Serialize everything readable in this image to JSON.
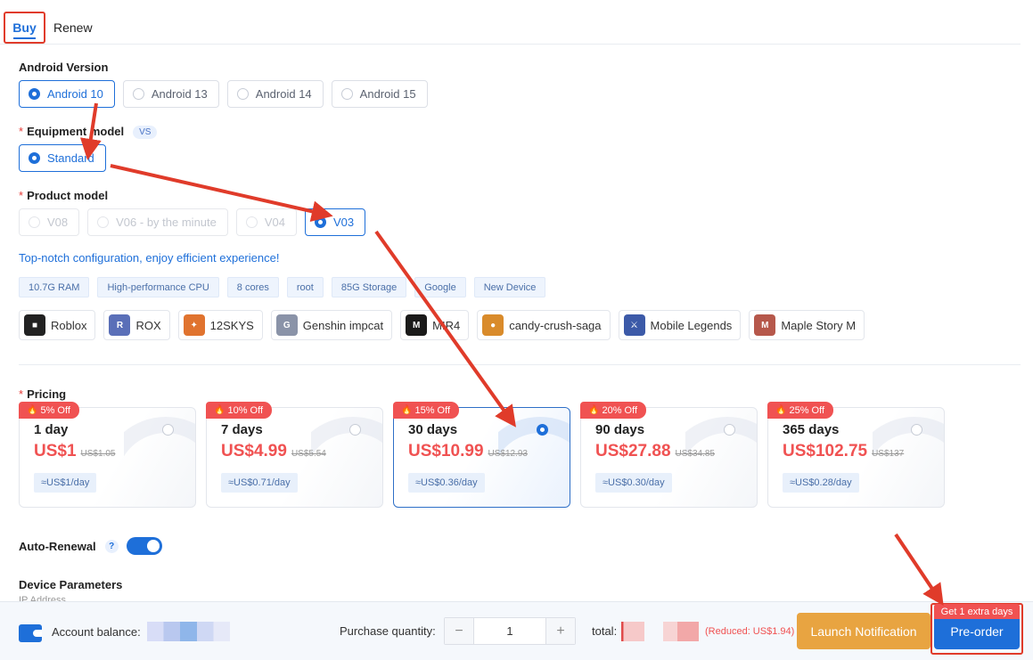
{
  "tabs": [
    {
      "label": "Buy",
      "active": true
    },
    {
      "label": "Renew",
      "active": false
    }
  ],
  "android_version": {
    "label": "Android Version",
    "options": [
      {
        "label": "Android 10",
        "selected": true
      },
      {
        "label": "Android 13",
        "selected": false
      },
      {
        "label": "Android 14",
        "selected": false
      },
      {
        "label": "Android 15",
        "selected": false
      }
    ]
  },
  "equipment_model": {
    "label": "Equipment model",
    "badge": "VS",
    "options": [
      {
        "label": "Standard",
        "selected": true
      }
    ]
  },
  "product_model": {
    "label": "Product model",
    "options": [
      {
        "label": "V08",
        "state": "disabled"
      },
      {
        "label": "V06 - by the minute",
        "state": "disabled"
      },
      {
        "label": "V04",
        "state": "disabled"
      },
      {
        "label": "V03",
        "state": "selected"
      }
    ]
  },
  "tagline": "Top-notch configuration, enjoy efficient experience!",
  "specs": [
    "10.7G RAM",
    "High-performance CPU",
    "8 cores",
    "root",
    "85G Storage",
    "Google",
    "New Device"
  ],
  "games": [
    {
      "label": "Roblox",
      "icon": "roblox-icon",
      "color": "#222222"
    },
    {
      "label": "ROX",
      "icon": "rox-icon",
      "color": "#5a6fb8"
    },
    {
      "label": "12SKYS",
      "icon": "12skys-icon",
      "color": "#e0732f"
    },
    {
      "label": "Genshin impcat",
      "icon": "genshin-icon",
      "color": "#8a93a8"
    },
    {
      "label": "MIR4",
      "icon": "mir4-icon",
      "color": "#1a1a1a"
    },
    {
      "label": "candy-crush-saga",
      "icon": "candy-crush-icon",
      "color": "#d98b2b"
    },
    {
      "label": "Mobile Legends",
      "icon": "mobile-legends-icon",
      "color": "#3c5aa8"
    },
    {
      "label": "Maple Story M",
      "icon": "maple-story-icon",
      "color": "#b6584b"
    }
  ],
  "pricing": {
    "label": "Pricing",
    "plans": [
      {
        "discount": "5% Off",
        "duration": "1 day",
        "price": "US$1",
        "original": "US$1.05",
        "per_day": "≈US$1/day",
        "selected": false
      },
      {
        "discount": "10% Off",
        "duration": "7 days",
        "price": "US$4.99",
        "original": "US$5.54",
        "per_day": "≈US$0.71/day",
        "selected": false
      },
      {
        "discount": "15% Off",
        "duration": "30 days",
        "price": "US$10.99",
        "original": "US$12.93",
        "per_day": "≈US$0.36/day",
        "selected": true
      },
      {
        "discount": "20% Off",
        "duration": "90 days",
        "price": "US$27.88",
        "original": "US$34.85",
        "per_day": "≈US$0.30/day",
        "selected": false
      },
      {
        "discount": "25% Off",
        "duration": "365 days",
        "price": "US$102.75",
        "original": "US$137",
        "per_day": "≈US$0.28/day",
        "selected": false
      }
    ]
  },
  "auto_renewal": {
    "label": "Auto-Renewal",
    "help": "?",
    "enabled": true
  },
  "device_parameters": {
    "label": "Device Parameters"
  },
  "bottom_bar": {
    "balance_label": "Account balance:",
    "quantity_label": "Purchase quantity:",
    "quantity": "1",
    "minus": "−",
    "plus": "+",
    "total_label": "total:",
    "reduced": "(Reduced: US$1.94)",
    "notify_button": "Launch Notification",
    "preorder_button": "Pre-order",
    "extra_badge": "Get 1 extra days"
  },
  "colors": {
    "accent": "#1e6fd9",
    "discount": "#f05252",
    "notify": "#e8a441",
    "annotation": "#e03b2a"
  }
}
